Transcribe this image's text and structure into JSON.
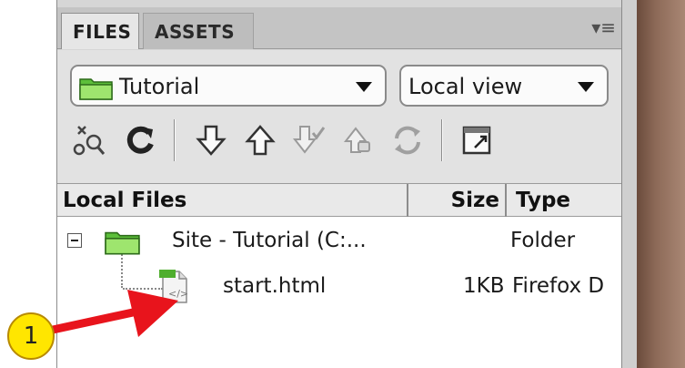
{
  "tabs": [
    {
      "label": "FILES",
      "active": true
    },
    {
      "label": "ASSETS",
      "active": false
    }
  ],
  "site_dropdown": {
    "value": "Tutorial",
    "icon": "folder-icon"
  },
  "view_dropdown": {
    "value": "Local view"
  },
  "toolbar": {
    "icons": [
      "connect-icon",
      "refresh-icon",
      "get-files-icon",
      "put-files-icon",
      "check-out-icon",
      "check-in-icon",
      "synchronize-icon",
      "expand-icon"
    ]
  },
  "columns": {
    "local": "Local Files",
    "size": "Size",
    "type": "Type"
  },
  "rows": [
    {
      "name": "Site - Tutorial (C:...",
      "size": "",
      "type": "Folder"
    },
    {
      "name": "start.html",
      "size": "1KB",
      "type": "Firefox D"
    }
  ],
  "callout": {
    "number": "1"
  },
  "colors": {
    "callout_fill": "#ffe600",
    "arrow": "#e8141c",
    "folder": "#7ed957"
  }
}
